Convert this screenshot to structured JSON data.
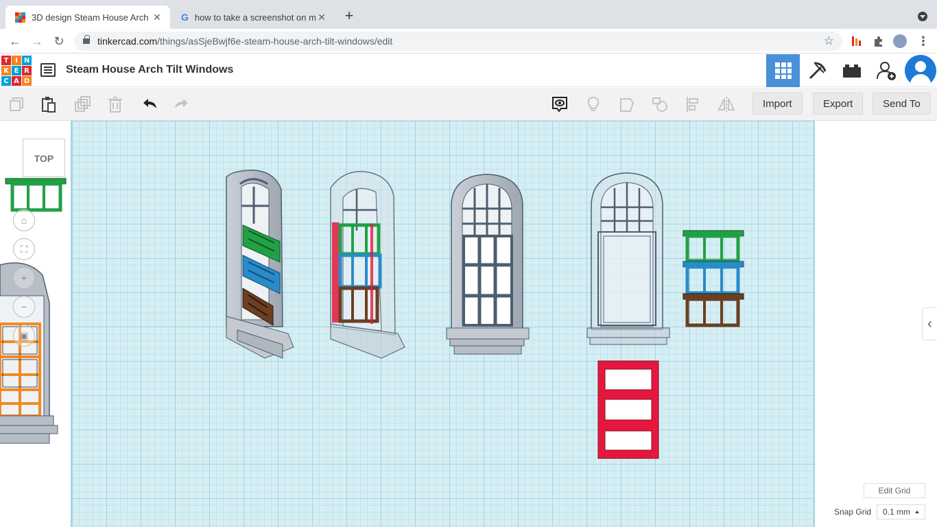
{
  "browser": {
    "tabs": [
      {
        "title": "3D design Steam House Arch T",
        "active": true
      },
      {
        "title": "how to take a screenshot on m",
        "active": false
      }
    ],
    "url_domain": "tinkercad.com",
    "url_path": "/things/asSjeBwjf6e-steam-house-arch-tilt-windows/edit"
  },
  "app": {
    "logo_letters": [
      "T",
      "I",
      "N",
      "K",
      "E",
      "R",
      "C",
      "A",
      "D"
    ],
    "logo_colors": [
      "#e2262b",
      "#f58220",
      "#00a0d6",
      "#f58220",
      "#00a0d6",
      "#e2262b",
      "#00a0d6",
      "#e2262b",
      "#f58220"
    ],
    "design_title": "Steam House Arch Tilt Windows"
  },
  "toolbar": {
    "import_label": "Import",
    "export_label": "Export",
    "send_to_label": "Send To"
  },
  "viewcube": {
    "face_label": "TOP"
  },
  "grid_controls": {
    "edit_grid_label": "Edit Grid",
    "snap_grid_label": "Snap Grid",
    "snap_grid_value": "0.1 mm"
  },
  "colors": {
    "accent": "#4a90d9",
    "window_gray": "#b7bec6",
    "green": "#22a046",
    "blue": "#2a8bc9",
    "brown": "#6b3f22",
    "red": "#e5173f",
    "orange": "#f08a24"
  }
}
